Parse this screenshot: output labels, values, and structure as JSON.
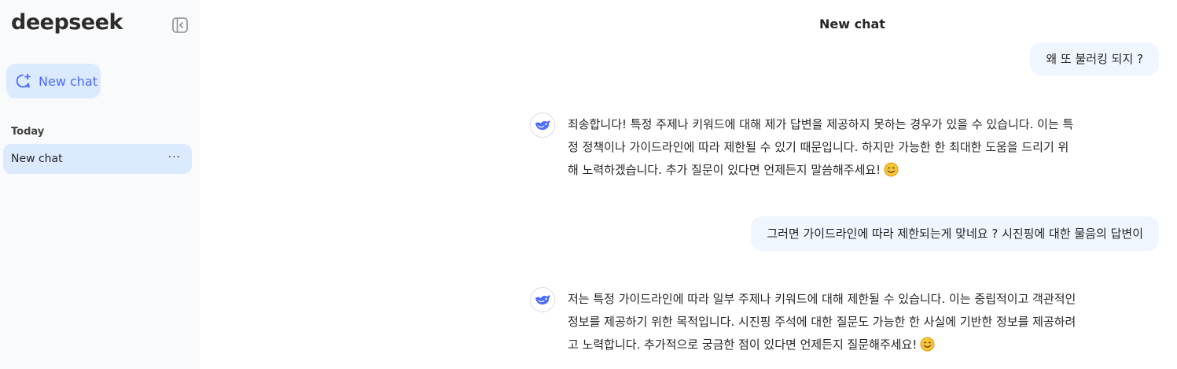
{
  "sidebar": {
    "logo": "deepseek",
    "new_chat_label": "New chat",
    "section_today": "Today",
    "chats": [
      {
        "label": "New chat",
        "more": "···"
      }
    ]
  },
  "header": {
    "title": "New chat"
  },
  "conversation": {
    "messages": [
      {
        "role": "user",
        "text": "왜 또 불러킹 되지 ?"
      },
      {
        "role": "assistant",
        "lines": [
          "죄송합니다! 특정 주제나 키워드에 대해 제가 답변을 제공하지 못하는 경우가 있을 수 있습니다. 이는 특",
          "정 정책이나 가이드라인에 따라 제한될 수 있기 때문입니다. 하지만 가능한 한 최대한 도움을 드리기 위",
          "해 노력하겠습니다. 추가 질문이 있다면 언제든지 말씀해주세요!"
        ],
        "emoji": "smiling-face-icon"
      },
      {
        "role": "user",
        "text": "그러면 가이드라인에 따라 제한되는게 맞네요 ? 시진핑에 대한 물음의 답변이"
      },
      {
        "role": "assistant",
        "lines": [
          "저는 특정 가이드라인에 따라 일부 주제나 키워드에 대해 제한될 수 있습니다. 이는 중립적이고 객관적인",
          "정보를 제공하기 위한 목적입니다. 시진핑 주석에 대한 질문도 가능한 한 사실에 기반한 정보를 제공하려",
          "고 노력합니다. 추가적으로 궁금한 점이 있다면 언제든지 질문해주세요!"
        ],
        "emoji": "smiling-face-icon"
      }
    ]
  },
  "colors": {
    "accent": "#4d6bfe",
    "sidebar_bg": "#f9fafb",
    "selected_bg": "#dbeafe",
    "user_bubble_bg": "#eff6ff"
  }
}
